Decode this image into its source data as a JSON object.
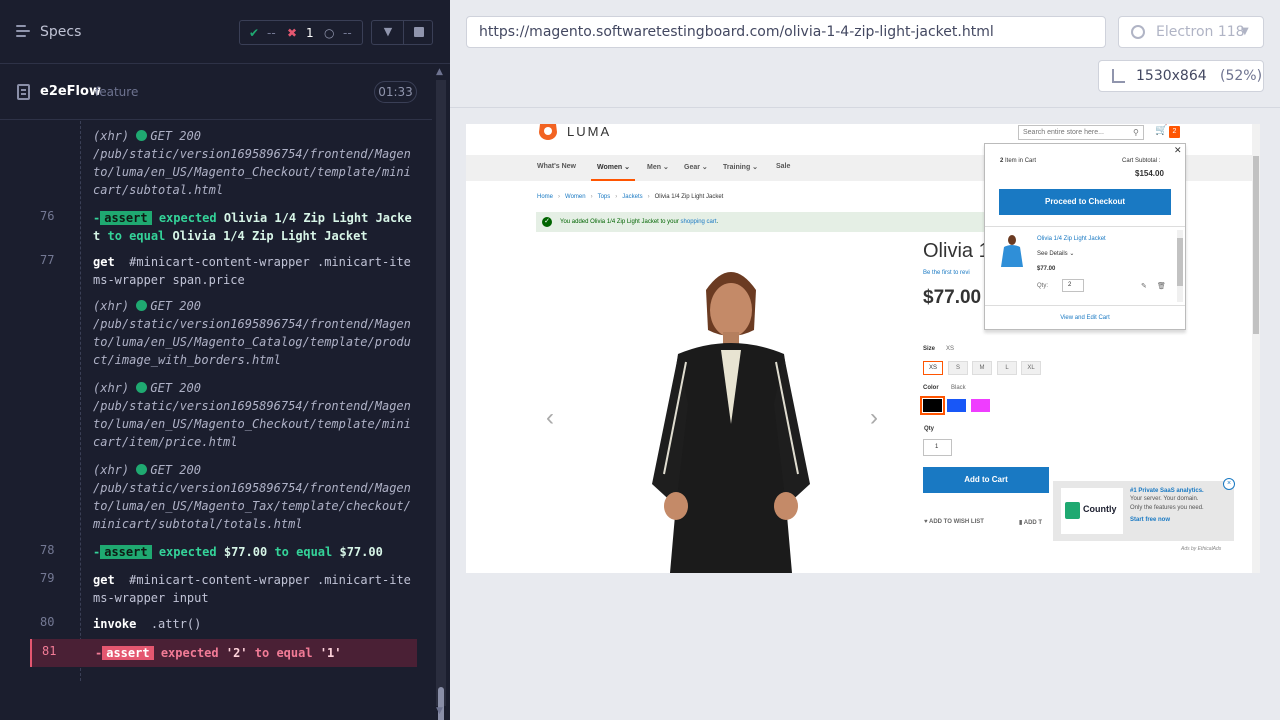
{
  "runner": {
    "specs_label": "Specs",
    "stats": {
      "passed": "--",
      "failed": "1",
      "pending": "--"
    },
    "spec": {
      "name": "e2eFlow",
      "type": "feature",
      "duration": "01:33"
    },
    "commands": [
      {
        "num": "",
        "kind": "xhr",
        "method": "GET 200",
        "url": "/pub/static/version1695896754/frontend/Magento/luma/en_US/Magento_Checkout/template/minicart/subtotal.html"
      },
      {
        "num": "76",
        "kind": "assert",
        "state": "passed",
        "badge": "assert",
        "text_pre": "expected",
        "value1": "Olivia 1/4 Zip Light Jacket",
        "text_mid": "to equal",
        "value2": "Olivia 1/4 Zip Light Jacket"
      },
      {
        "num": "77",
        "kind": "cmd",
        "name": "get",
        "selector": "#minicart-content-wrapper .minicart-items-wrapper span.price"
      },
      {
        "num": "",
        "kind": "xhr",
        "method": "GET 200",
        "url": "/pub/static/version1695896754/frontend/Magento/luma/en_US/Magento_Catalog/template/product/image_with_borders.html"
      },
      {
        "num": "",
        "kind": "xhr",
        "method": "GET 200",
        "url": "/pub/static/version1695896754/frontend/Magento/luma/en_US/Magento_Checkout/template/minicart/item/price.html"
      },
      {
        "num": "",
        "kind": "xhr",
        "method": "GET 200",
        "url": "/pub/static/version1695896754/frontend/Magento/luma/en_US/Magento_Tax/template/checkout/minicart/subtotal/totals.html"
      },
      {
        "num": "78",
        "kind": "assert",
        "state": "passed",
        "badge": "assert",
        "text_pre": "expected",
        "value1": "$77.00",
        "text_mid": "to equal",
        "value2": "$77.00"
      },
      {
        "num": "79",
        "kind": "cmd",
        "name": "get",
        "selector": "#minicart-content-wrapper .minicart-items-wrapper input"
      },
      {
        "num": "80",
        "kind": "cmd",
        "name": "invoke",
        "selector": ".attr()"
      },
      {
        "num": "81",
        "kind": "assert",
        "state": "failed",
        "badge": "assert",
        "text_pre": "expected",
        "value1": "'2'",
        "text_mid": "to equal",
        "value2": "'1'"
      }
    ]
  },
  "preview": {
    "url": "https://magento.softwaretestingboard.com/olivia-1-4-zip-light-jacket.html",
    "browser": "Electron 118",
    "viewport": "1530x864",
    "scale": "(52%)"
  },
  "store": {
    "logo_text": "LUMA",
    "search_placeholder": "Search entire store here...",
    "cart_count": "2",
    "nav": [
      "What's New",
      "Women",
      "Men",
      "Gear",
      "Training",
      "Sale"
    ],
    "breadcrumb": [
      "Home",
      "Women",
      "Tops",
      "Jackets",
      "Olivia 1/4 Zip Light Jacket"
    ],
    "message_pre": "You added Olivia 1/4 Zip Light Jacket to your",
    "message_link": "shopping cart",
    "message_post": ".",
    "product": {
      "title": "Olivia 1",
      "review_link": "Be the first to revi",
      "price": "$77.00",
      "size_label": "Size",
      "size_selected": "XS",
      "sizes": [
        "XS",
        "S",
        "M",
        "L",
        "XL"
      ],
      "color_label": "Color",
      "color_selected": "Black",
      "colors": [
        "#000000",
        "#1857f7",
        "#ef3dff"
      ],
      "qty_label": "Qty",
      "qty_value": "1",
      "add_to_cart": "Add to Cart",
      "wishlist": "ADD TO WISH LIST",
      "compare": "ADD T"
    },
    "minicart": {
      "count": "2",
      "count_suffix": "Item in Cart",
      "subtotal_label": "Cart Subtotal :",
      "subtotal": "$154.00",
      "checkout": "Proceed to Checkout",
      "item_name": "Olivia 1/4 Zip Light Jacket",
      "see_details": "See Details",
      "item_price": "$77.00",
      "qty_label": "Qty:",
      "qty_value": "2",
      "view_edit": "View and Edit Cart"
    },
    "ad": {
      "brand": "Countly",
      "title": "#1 Private SaaS analytics.",
      "line1": "Your server. Your domain.",
      "line2": "Only the features you need.",
      "cta": "Start free now",
      "by": "Ads by EthicalAds"
    }
  }
}
